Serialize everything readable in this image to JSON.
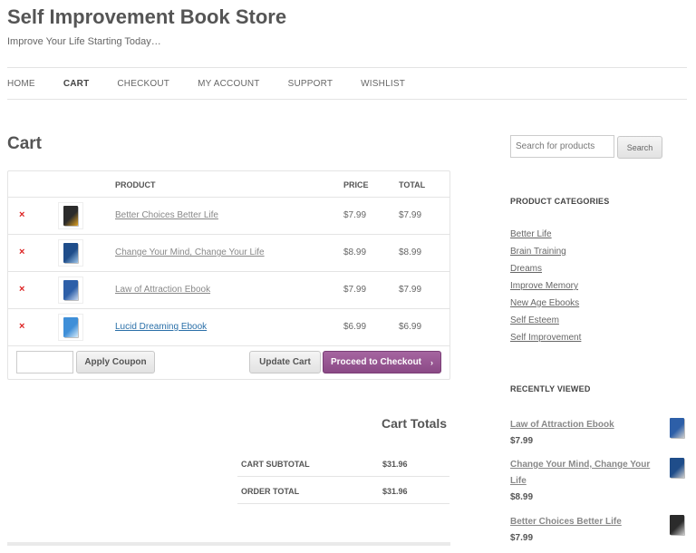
{
  "site": {
    "title": "Self Improvement Book Store",
    "tagline": "Improve Your Life Starting Today…"
  },
  "nav": {
    "items": [
      {
        "label": "HOME"
      },
      {
        "label": "CART"
      },
      {
        "label": "CHECKOUT"
      },
      {
        "label": "MY ACCOUNT"
      },
      {
        "label": "SUPPORT"
      },
      {
        "label": "WISHLIST"
      }
    ],
    "active": "CART"
  },
  "page_title": "Cart",
  "cart": {
    "headers": {
      "product": "PRODUCT",
      "price": "PRICE",
      "total": "TOTAL"
    },
    "remove_icon": "×",
    "items": [
      {
        "name": "Better Choices Better Life",
        "price": "$7.99",
        "total": "$7.99",
        "thumb_color": "#2b2b2b",
        "thumb_accent": "#e0a020"
      },
      {
        "name": "Change Your Mind, Change Your Life",
        "price": "$8.99",
        "total": "$8.99",
        "thumb_color": "#1f4d8a",
        "thumb_accent": "#9cc4e8"
      },
      {
        "name": "Law of Attraction Ebook",
        "price": "$7.99",
        "total": "$7.99",
        "thumb_color": "#2d5fa8",
        "thumb_accent": "#c8d8f0"
      },
      {
        "name": "Lucid Dreaming Ebook",
        "price": "$6.99",
        "total": "$6.99",
        "thumb_color": "#3f8fd8",
        "thumb_accent": "#d8ecfa"
      }
    ],
    "coupon_placeholder": "",
    "apply_coupon_label": "Apply Coupon",
    "update_cart_label": "Update Cart",
    "checkout_label": "Proceed to Checkout",
    "checkout_arrow": "›"
  },
  "totals": {
    "title": "Cart Totals",
    "subtotal_label": "CART SUBTOTAL",
    "subtotal_value": "$31.96",
    "order_total_label": "ORDER TOTAL",
    "order_total_value": "$31.96"
  },
  "sidebar": {
    "search_placeholder": "Search for products",
    "search_button": "Search",
    "categories_title": "PRODUCT CATEGORIES",
    "categories": [
      "Better Life",
      "Brain Training",
      "Dreams",
      "Improve Memory",
      "New Age Ebooks",
      "Self Esteem",
      "Self Improvement"
    ],
    "recently_viewed_title": "RECENTLY VIEWED",
    "recently_viewed": [
      {
        "name": "Law of Attraction Ebook",
        "price": "$7.99",
        "thumb_color": "#2d5fa8"
      },
      {
        "name": "Change Your Mind, Change Your Life",
        "price": "$8.99",
        "thumb_color": "#1f4d8a"
      },
      {
        "name": "Better Choices Better Life",
        "price": "$7.99",
        "thumb_color": "#2b2b2b"
      }
    ]
  },
  "colors": {
    "checkout_button": "#95528f",
    "remove_icon": "#dd2222",
    "visited_link": "#2a6fa8"
  }
}
